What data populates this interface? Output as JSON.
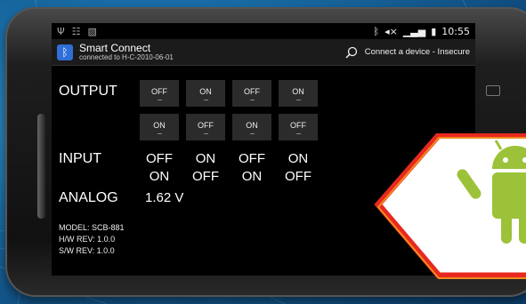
{
  "statusbar": {
    "left_icons": [
      "usb-icon",
      "android-debug-icon",
      "image-icon"
    ],
    "time": "10:55"
  },
  "app": {
    "title": "Smart Connect",
    "subtitle": "connected to H-C-2010-06-01",
    "connect_action": "Connect a device - Insecure"
  },
  "output": {
    "label": "OUTPUT",
    "row1": [
      "OFF",
      "ON",
      "OFF",
      "ON"
    ],
    "row2": [
      "ON",
      "OFF",
      "ON",
      "OFF"
    ]
  },
  "input": {
    "label": "INPUT",
    "row1": [
      "OFF",
      "ON",
      "OFF",
      "ON"
    ],
    "row2": [
      "ON",
      "OFF",
      "ON",
      "OFF"
    ]
  },
  "analog": {
    "label": "ANALOG",
    "value": "1.62 V"
  },
  "info": {
    "model": "MODEL: SCB-881",
    "hw": "H/W REV: 1.0.0",
    "sw": "S/W REV: 1.0.0"
  },
  "colors": {
    "accent_bt": "#2f6fd6",
    "badge_border": "#e8281f",
    "android_green": "#9cc23a"
  }
}
